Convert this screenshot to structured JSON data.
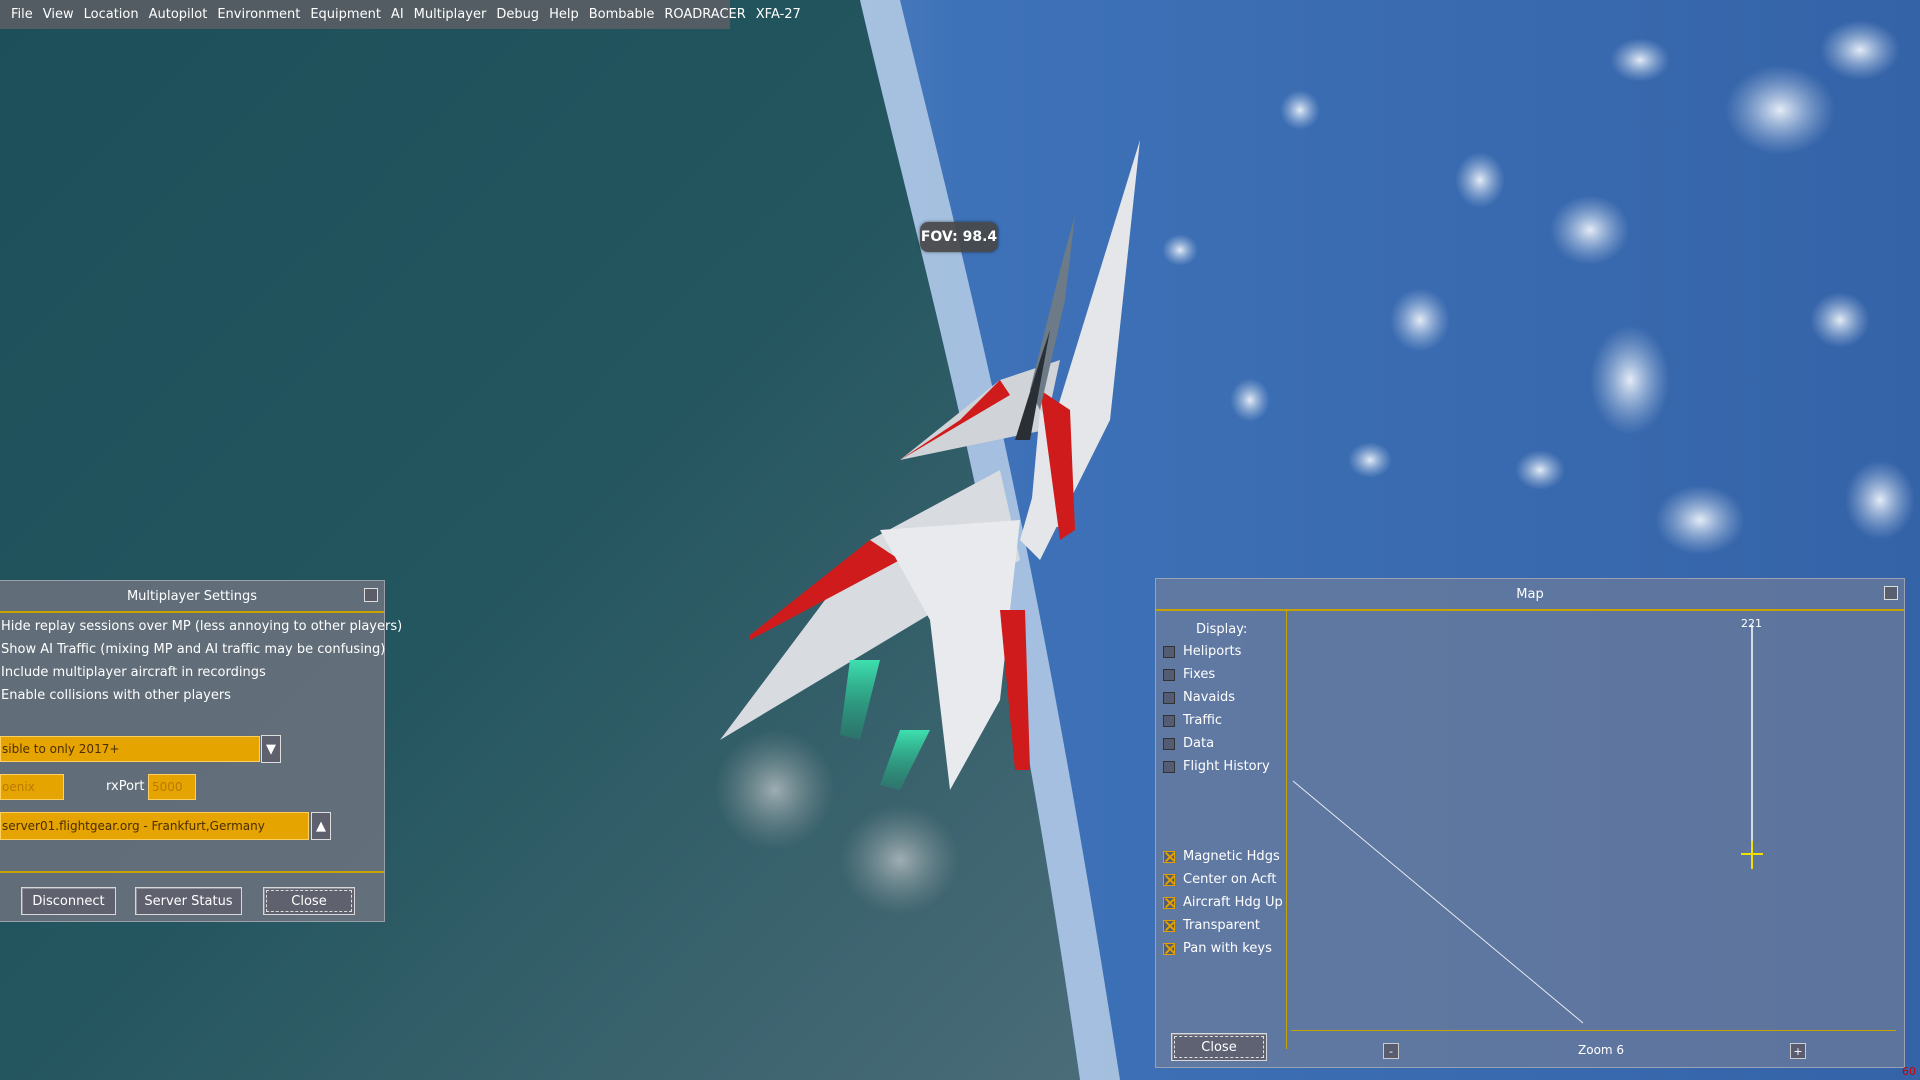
{
  "menubar": {
    "items": [
      "File",
      "View",
      "Location",
      "Autopilot",
      "Environment",
      "Equipment",
      "AI",
      "Multiplayer",
      "Debug",
      "Help",
      "Bombable",
      "ROADRACER",
      "XFA-27"
    ]
  },
  "hud": {
    "fov": "FOV: 98.4"
  },
  "mp_settings": {
    "title": "Multiplayer Settings",
    "options": [
      "Hide replay sessions over MP (less annoying to other players)",
      "Show AI Traffic (mixing MP and AI traffic may be confusing)",
      "Include multiplayer aircraft in recordings",
      "Enable collisions with other players"
    ],
    "visibility_value": "sible to only 2017+",
    "callsign_value": "oenix",
    "rxport_label": "rxPort",
    "rxport_value": "5000",
    "server_value": "server01.flightgear.org - Frankfurt,Germany",
    "buttons": {
      "disconnect": "Disconnect",
      "server_status": "Server Status",
      "close": "Close"
    }
  },
  "map": {
    "title": "Map",
    "display_label": "Display:",
    "checkboxes_top": [
      {
        "label": "Heliports",
        "checked": false
      },
      {
        "label": "Fixes",
        "checked": false
      },
      {
        "label": "Navaids",
        "checked": false
      },
      {
        "label": "Traffic",
        "checked": false
      },
      {
        "label": "Data",
        "checked": false
      },
      {
        "label": "Flight History",
        "checked": false
      }
    ],
    "checkboxes_bottom": [
      {
        "label": "Magnetic Hdgs",
        "checked": true
      },
      {
        "label": "Center on Acft",
        "checked": true
      },
      {
        "label": "Aircraft Hdg Up",
        "checked": true
      },
      {
        "label": "Transparent",
        "checked": true
      },
      {
        "label": "Pan with keys",
        "checked": true
      }
    ],
    "heading_label": "221",
    "zoom_label": "Zoom 6",
    "zoom_out": "-",
    "zoom_in": "+",
    "close": "Close"
  },
  "fps": "60",
  "colors": {
    "accent": "#c8a200",
    "field": "#e6a400",
    "dialog_bg": "#737682"
  },
  "icons": [
    "close-box-icon",
    "dropdown-arrow-icon",
    "dropup-arrow-icon",
    "aircraft-position-cross-icon"
  ]
}
